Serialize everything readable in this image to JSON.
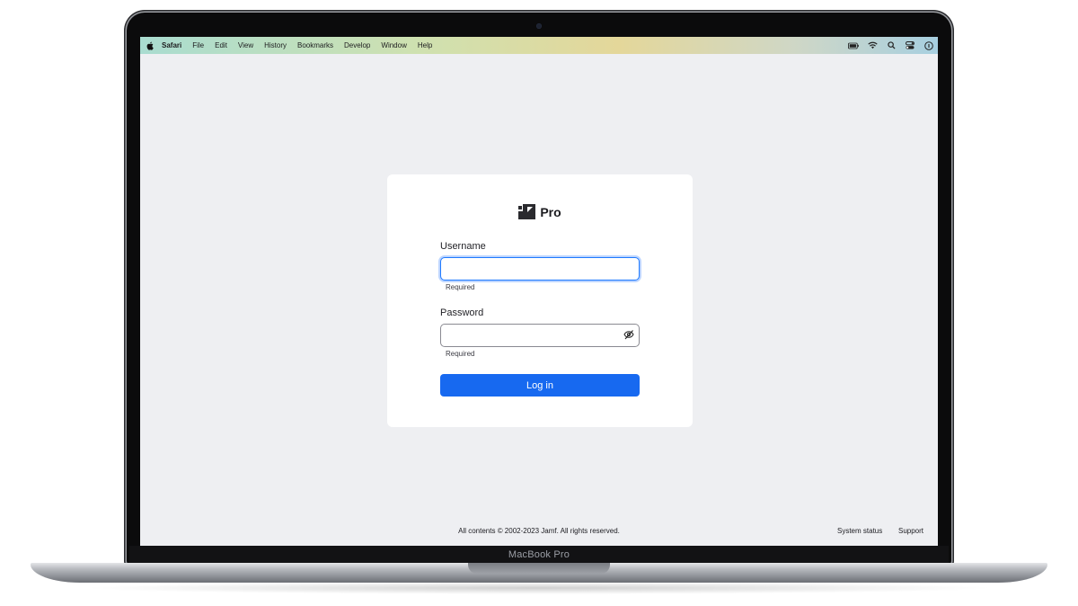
{
  "device": {
    "chin_label": "MacBook Pro"
  },
  "menubar": {
    "app_name": "Safari",
    "items": [
      "File",
      "Edit",
      "View",
      "History",
      "Bookmarks",
      "Develop",
      "Window",
      "Help"
    ],
    "tray_icons": [
      "battery-icon",
      "wifi-icon",
      "spotlight-search-icon",
      "control-center-icon",
      "siri-icon"
    ]
  },
  "login": {
    "brand_text": "Pro",
    "username_label": "Username",
    "username_value": "",
    "username_hint": "Required",
    "password_label": "Password",
    "password_value": "",
    "password_hint": "Required",
    "login_button": "Log in",
    "accent_color": "#1769f0"
  },
  "footer": {
    "copyright": "All contents © 2002-2023 Jamf. All rights reserved.",
    "system_status": "System status",
    "support": "Support"
  }
}
